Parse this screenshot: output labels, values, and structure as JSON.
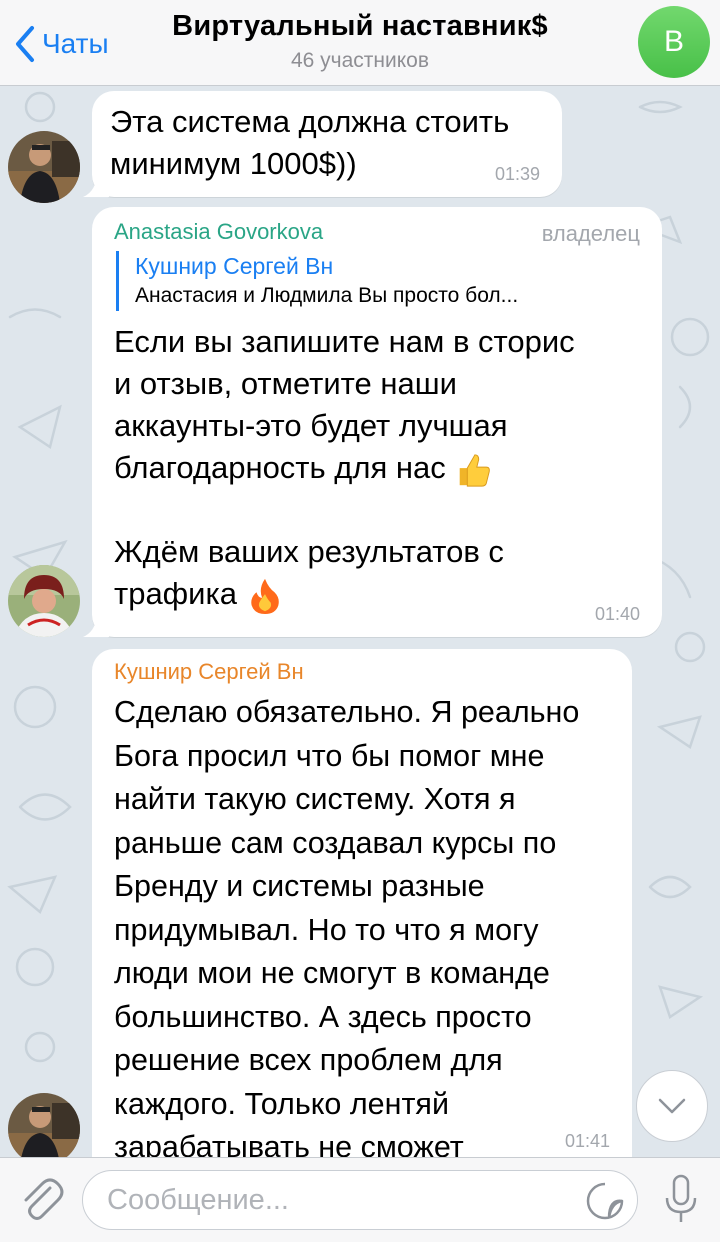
{
  "header": {
    "back_label": "Чаты",
    "title": "Виртуальный наставник$",
    "subtitle": "46 участников",
    "avatar_letter": "В"
  },
  "messages": [
    {
      "text": "Эта система должна стоить\nминимум 1000$))",
      "time": "01:39"
    },
    {
      "sender": "Anastasia Govorkova",
      "role": "владелец",
      "reply_name": "Кушнир Сергей Вн",
      "reply_text": "Анастасия и Людмила Вы просто бол...",
      "text_part1": "Если вы запишите нам в сторис\nи отзыв, отметите наши\nаккаунты-это будет лучшая\nблагодарность для нас",
      "text_part2": "Ждём ваших результатов с\nтрафика",
      "time": "01:40",
      "emoji_1": "thumbs-up",
      "emoji_2": "fire"
    },
    {
      "sender": "Кушнир Сергей Вн",
      "text": "Сделаю обязательно. Я реально\nБога просил что бы помог мне\nнайти такую систему. Хотя я\nраньше сам создавал курсы по\nБренду и системы разные\nпридумывал. Но то что я могу\nлюди мои не смогут в команде\nбольшинство. А здесь просто\nрешение всех проблем для\nкаждого. Только лентяй\nзарабатывать не сможет",
      "time": "01:41"
    }
  ],
  "input": {
    "placeholder": "Сообщение..."
  },
  "colors": {
    "accent": "#1a7ff2",
    "sender_owner": "#2aa586",
    "sender_member": "#e8862a",
    "group_avatar": "#58c756",
    "chat_bg": "#dfe6ec"
  }
}
